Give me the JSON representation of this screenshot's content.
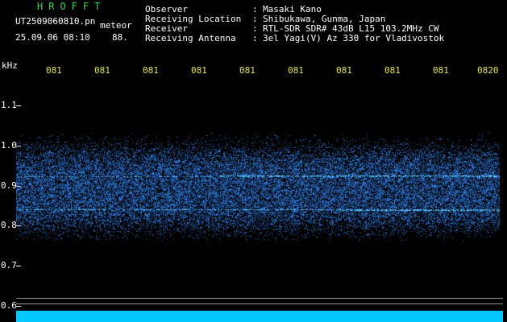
{
  "header": {
    "brand": "HROFFT",
    "filename": "UT2509060810.pn",
    "mode": "meteor",
    "datetime": "25.09.06 08:10",
    "count": "88.",
    "fields": [
      {
        "label": "Observer",
        "value": "Masaki Kano"
      },
      {
        "label": "Receiving Location",
        "value": "Shibukawa, Gunma, Japan"
      },
      {
        "label": "Receiver",
        "value": "RTL-SDR SDR# 43dB L15 103.2MHz CW"
      },
      {
        "label": "Receiving Antenna",
        "value": "3el Yagi(V) Az 330 for Vladivostok"
      }
    ]
  },
  "axis": {
    "unit": "kHz",
    "y_ticks": [
      {
        "label": "1.1",
        "value": 1.1
      },
      {
        "label": "1.0",
        "value": 1.0
      },
      {
        "label": "0.9",
        "value": 0.9
      },
      {
        "label": "0.8",
        "value": 0.8
      },
      {
        "label": "0.7",
        "value": 0.7
      },
      {
        "label": "0.6",
        "value": 0.6
      }
    ],
    "x_ticks": [
      "081",
      "081",
      "081",
      "081",
      "081",
      "081",
      "081",
      "081",
      "081",
      "0820"
    ]
  },
  "colors": {
    "header_brand": "#39d353",
    "text": "#ffffff",
    "time_labels": "#e8e84a",
    "signal": "#4fa3ff",
    "bar": "#00c8ff"
  }
}
